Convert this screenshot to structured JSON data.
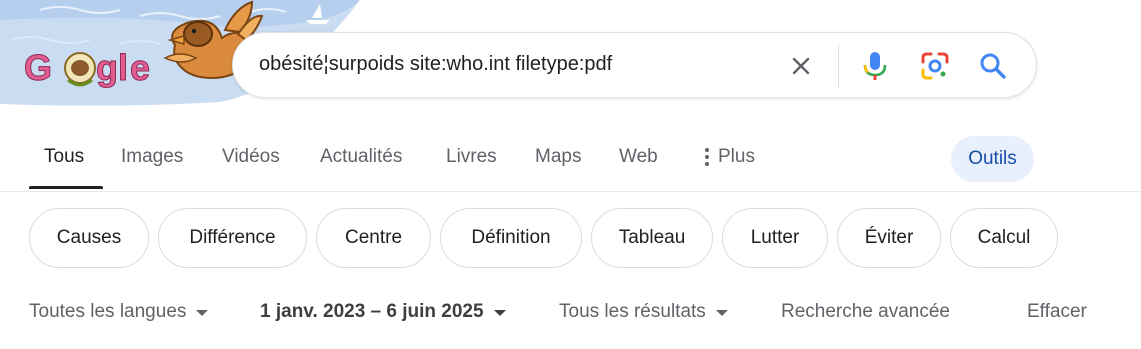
{
  "doodle": {
    "logo_text": "Google"
  },
  "search": {
    "query": "obésité¦surpoids site:who.int filetype:pdf"
  },
  "icons": {
    "clear": "close-icon",
    "mic": "microphone-icon",
    "lens": "google-lens-icon",
    "search": "search-icon",
    "more": "vertical-dots-icon"
  },
  "tabs": [
    {
      "label": "Tous",
      "active": true
    },
    {
      "label": "Images"
    },
    {
      "label": "Vidéos"
    },
    {
      "label": "Actualités"
    },
    {
      "label": "Livres"
    },
    {
      "label": "Maps"
    },
    {
      "label": "Web"
    },
    {
      "label": "Plus"
    }
  ],
  "tools_label": "Outils",
  "chips": [
    "Causes",
    "Différence",
    "Centre",
    "Définition",
    "Tableau",
    "Lutter",
    "Éviter",
    "Calcul"
  ],
  "filters": {
    "language": "Toutes les langues",
    "date_range": "1 janv. 2023 – 6 juin 2025",
    "results": "Tous les résultats",
    "advanced": "Recherche avancée",
    "clear": "Effacer"
  },
  "colors": {
    "accent_blue": "#4285f4",
    "tools_bg": "#e8f0fe",
    "tools_text": "#1a4fa8"
  }
}
